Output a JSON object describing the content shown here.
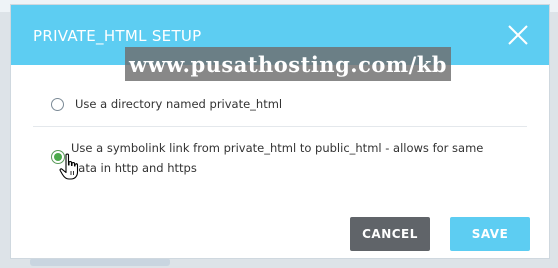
{
  "dialog": {
    "title": "PRIVATE_HTML SETUP",
    "watermark": "www.pusathosting.com/kb"
  },
  "options": [
    {
      "label": "Use a directory named private_html",
      "selected": false
    },
    {
      "label": "Use a symbolink link from private_html to public_html - allows for same data in http and https",
      "selected": true
    }
  ],
  "buttons": {
    "cancel": "CANCEL",
    "save": "SAVE"
  },
  "colors": {
    "header": "#5dcdf2",
    "cancel_button": "#606469",
    "save_button": "#5dcdf2",
    "selected_radio": "#4caa4c"
  },
  "icons": {
    "close": "close-icon",
    "pointer": "hand-cursor-icon"
  }
}
